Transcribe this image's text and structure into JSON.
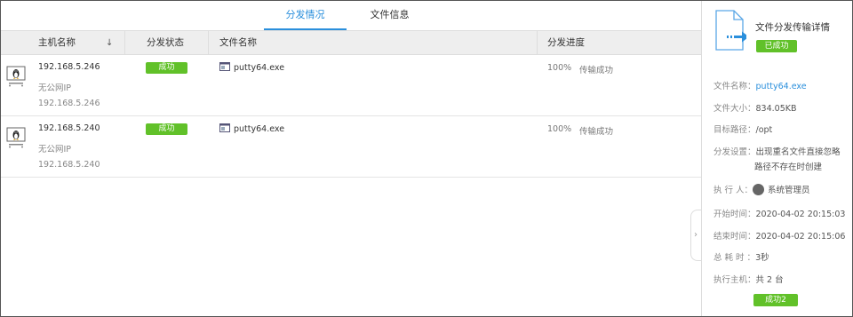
{
  "tabs": [
    {
      "label": "分发情况",
      "active": true
    },
    {
      "label": "文件信息",
      "active": false
    }
  ],
  "table": {
    "headers": {
      "host": "主机名称",
      "sort": "↓",
      "status": "分发状态",
      "file": "文件名称",
      "progress": "分发进度"
    },
    "rows": [
      {
        "os_icon": "linux-icon",
        "ip": "192.168.5.246",
        "public_ip": "无公网IP",
        "private_ip": "192.168.5.246",
        "status": "成功",
        "file_icon": "file-icon",
        "file": "putty64.exe",
        "percent": "100%",
        "progress_text": "传输成功"
      },
      {
        "os_icon": "linux-icon",
        "ip": "192.168.5.240",
        "public_ip": "无公网IP",
        "private_ip": "192.168.5.240",
        "status": "成功",
        "file_icon": "file-icon",
        "file": "putty64.exe",
        "percent": "100%",
        "progress_text": "传输成功"
      }
    ]
  },
  "panel": {
    "title": "文件分发传输详情",
    "status": "已成功",
    "file_name_label": "文件名称：",
    "file_name": "putty64.exe",
    "file_size_label": "文件大小：",
    "file_size": "834.05KB",
    "target_path_label": "目标路径：",
    "target_path": "/opt",
    "settings_label": "分发设置：",
    "settings_line1": "出现重名文件直接忽略",
    "settings_line2": "路径不存在时创建",
    "executor_label": "执 行 人：",
    "executor": "系统管理员",
    "start_label": "开始时间：",
    "start_time": "2020-04-02 20:15:03",
    "end_label": "结束时间：",
    "end_time": "2020-04-02 20:15:06",
    "duration_label": "总 耗 时 ：",
    "duration": "3秒",
    "hosts_label": "执行主机：",
    "hosts": "共 2 台",
    "success_badge": "成功2",
    "collapse_glyph": "›"
  },
  "colors": {
    "accent": "#2a8fdc",
    "success": "#61c129"
  }
}
